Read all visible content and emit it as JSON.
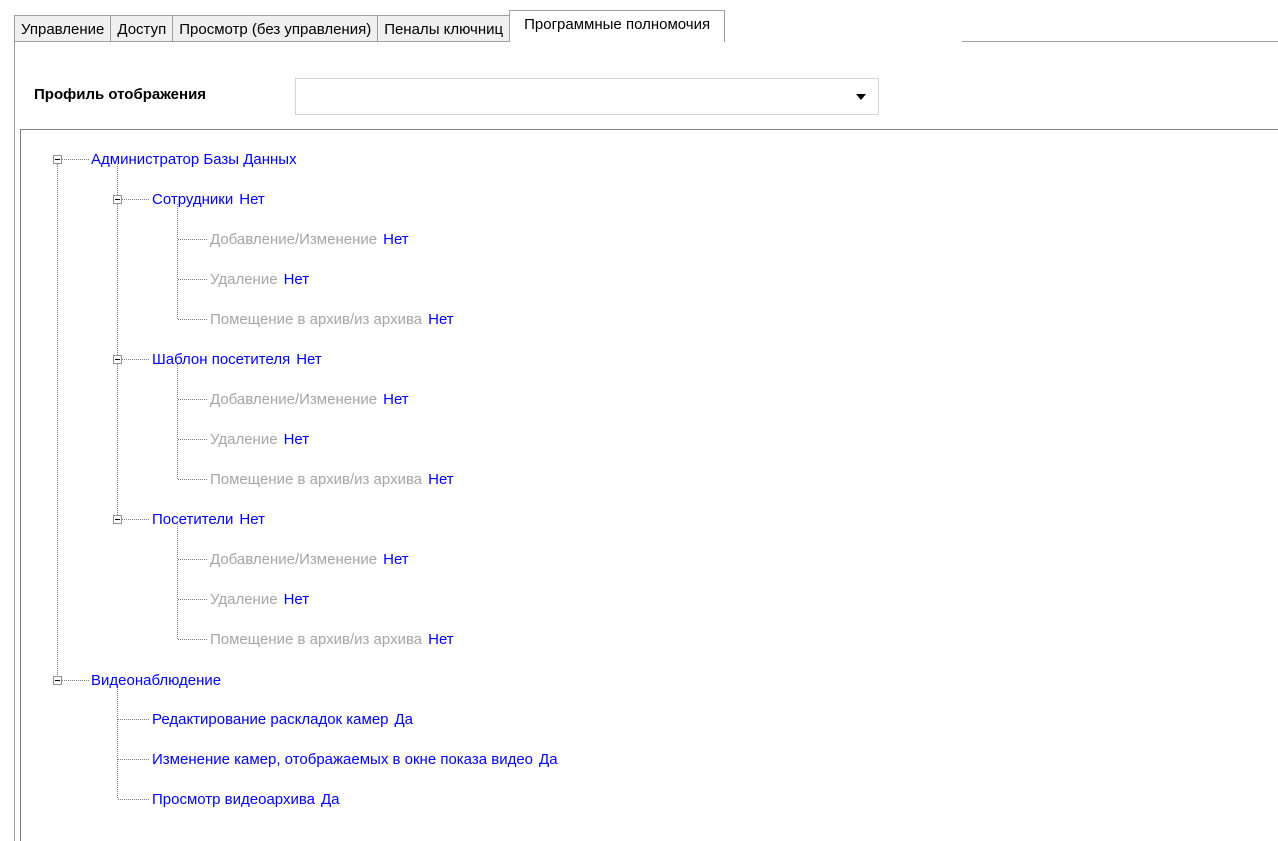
{
  "tabs": [
    {
      "label": "Управление"
    },
    {
      "label": "Доступ"
    },
    {
      "label": "Просмотр (без управления)"
    },
    {
      "label": "Пеналы ключниц"
    },
    {
      "label": "Программные полномочия"
    }
  ],
  "profile": {
    "label": "Профиль отображения",
    "value": ""
  },
  "tree": {
    "db_admin": {
      "label": "Администратор Базы Данных",
      "employees": {
        "label": "Сотрудники",
        "value": "Нет",
        "children": [
          {
            "label": "Добавление/Изменение",
            "value": "Нет"
          },
          {
            "label": "Удаление",
            "value": "Нет"
          },
          {
            "label": "Помещение в архив/из архива",
            "value": "Нет"
          }
        ]
      },
      "visitor_template": {
        "label": "Шаблон посетителя",
        "value": "Нет",
        "children": [
          {
            "label": "Добавление/Изменение",
            "value": "Нет"
          },
          {
            "label": "Удаление",
            "value": "Нет"
          },
          {
            "label": "Помещение в архив/из архива",
            "value": "Нет"
          }
        ]
      },
      "visitors": {
        "label": "Посетители",
        "value": "Нет",
        "children": [
          {
            "label": "Добавление/Изменение",
            "value": "Нет"
          },
          {
            "label": "Удаление",
            "value": "Нет"
          },
          {
            "label": "Помещение в архив/из архива",
            "value": "Нет"
          }
        ]
      }
    },
    "video": {
      "label": "Видеонаблюдение",
      "children": [
        {
          "label": "Редактирование раскладок камер",
          "value": "Да"
        },
        {
          "label": "Изменение камер, отображаемых в окне показа видео",
          "value": "Да"
        },
        {
          "label": "Просмотр видеоархива",
          "value": "Да"
        }
      ]
    }
  },
  "colors": {
    "enabled_text": "#0000ff",
    "disabled_text": "#a6a6a6",
    "tree_line": "#808080"
  }
}
